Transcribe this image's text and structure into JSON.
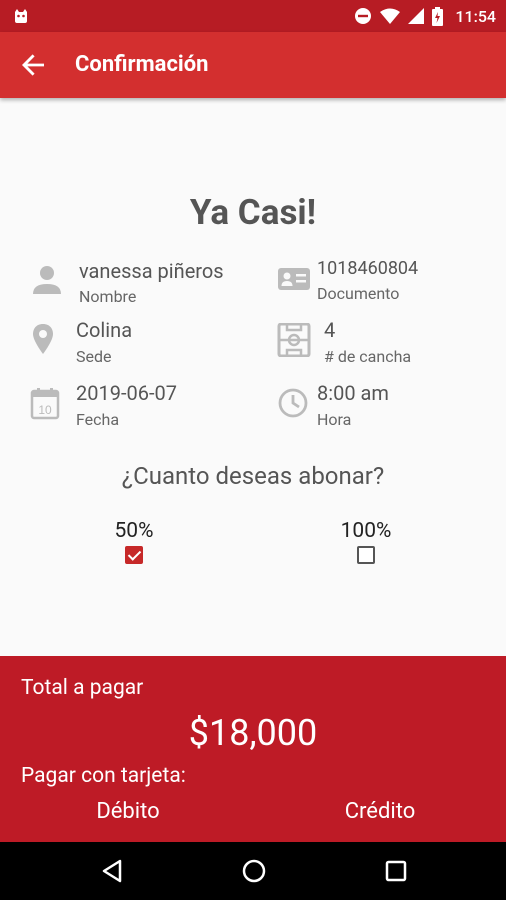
{
  "status_bar": {
    "time": "11:54"
  },
  "app_bar": {
    "title": "Confirmación"
  },
  "headline": "Ya Casi!",
  "info": {
    "name": {
      "value": "vanessa piñeros",
      "label": "Nombre"
    },
    "document": {
      "value": "1018460804",
      "label": "Documento"
    },
    "site": {
      "value": "Colina",
      "label": "Sede"
    },
    "court": {
      "value": "4",
      "label": "# de cancha"
    },
    "date": {
      "value": "2019-06-07",
      "label": "Fecha"
    },
    "time": {
      "value": "8:00 am",
      "label": "Hora"
    }
  },
  "question": "¿Cuanto deseas abonar?",
  "options": [
    {
      "label": "50%",
      "checked": true
    },
    {
      "label": "100%",
      "checked": false
    }
  ],
  "payment": {
    "total_label": "Total a pagar",
    "amount": "$18,000",
    "card_label": "Pagar con tarjeta:",
    "debit": "Débito",
    "credit": "Crédito"
  },
  "colors": {
    "primary": "#d32f2f",
    "status_bar": "#b71c24",
    "panel": "#be1b26"
  }
}
